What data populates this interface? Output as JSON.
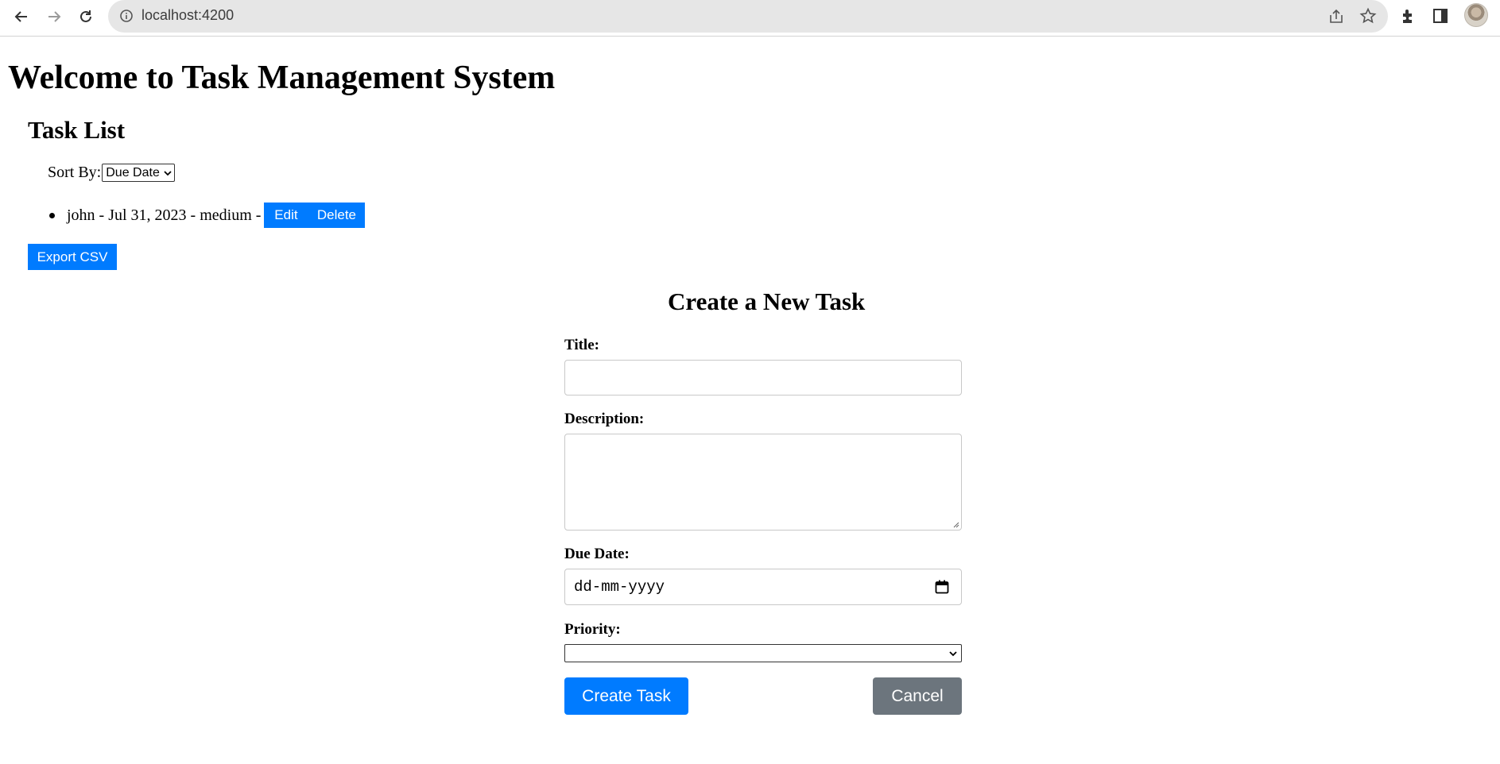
{
  "browser": {
    "url": "localhost:4200",
    "icons": [
      "back-arrow-icon",
      "forward-arrow-icon",
      "reload-icon",
      "info-icon",
      "share-icon",
      "star-icon",
      "extensions-icon",
      "side-panel-icon",
      "profile-avatar"
    ]
  },
  "page": {
    "title": "Welcome to Task Management System"
  },
  "task_list": {
    "heading": "Task List",
    "sort_label": "Sort By:",
    "sort_selected": "Due Date",
    "items": [
      {
        "text": "john - Jul 31, 2023 - medium -",
        "edit_label": "Edit",
        "delete_label": "Delete"
      }
    ],
    "export_label": "Export CSV"
  },
  "form": {
    "heading": "Create a New Task",
    "title_label": "Title:",
    "title_value": "",
    "description_label": "Description:",
    "description_value": "",
    "due_date_label": "Due Date:",
    "due_date_placeholder": "dd-mm-yyyy",
    "priority_label": "Priority:",
    "priority_selected": "",
    "create_label": "Create Task",
    "cancel_label": "Cancel"
  },
  "colors": {
    "primary": "#007bff",
    "secondary": "#6c757d"
  }
}
